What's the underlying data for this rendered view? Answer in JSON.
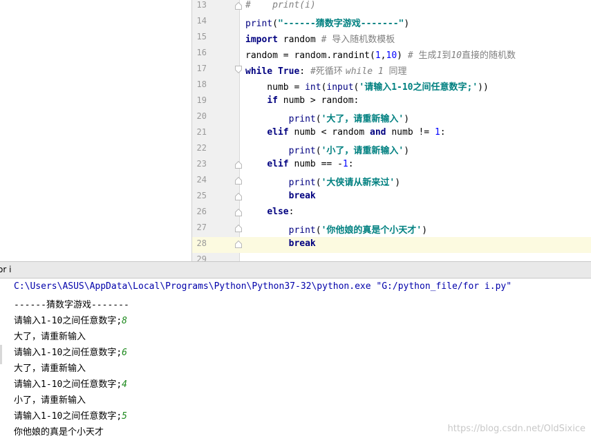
{
  "editor": {
    "lines": [
      {
        "num": "13",
        "tokens": [
          [
            "cmt",
            "#    print(i)"
          ]
        ]
      },
      {
        "num": "14",
        "tokens": [
          [
            "bi",
            "print"
          ],
          [
            "",
            "("
          ],
          [
            "str",
            "\"------猜数字游戏-------\""
          ],
          [
            "",
            ")"
          ]
        ]
      },
      {
        "num": "15",
        "tokens": [
          [
            "kw",
            "import"
          ],
          [
            "",
            " random "
          ],
          [
            "cmt",
            "# "
          ],
          [
            "cmt-zh",
            "导入随机数模板"
          ]
        ]
      },
      {
        "num": "16",
        "tokens": [
          [
            "",
            "random = random.randint("
          ],
          [
            "num",
            "1"
          ],
          [
            "",
            ","
          ],
          [
            "num",
            "10"
          ],
          [
            "",
            ") "
          ],
          [
            "cmt",
            "# "
          ],
          [
            "cmt-zh",
            "生成"
          ],
          [
            "cmt",
            "1"
          ],
          [
            "cmt-zh",
            "到"
          ],
          [
            "cmt",
            "10"
          ],
          [
            "cmt-zh",
            "直接的随机数"
          ]
        ]
      },
      {
        "num": "17",
        "tokens": [
          [
            "kw",
            "while"
          ],
          [
            "",
            " "
          ],
          [
            "kw",
            "True"
          ],
          [
            "",
            ": "
          ],
          [
            "cmt",
            "#"
          ],
          [
            "cmt-zh",
            "死循环 "
          ],
          [
            "cmt",
            "while 1 "
          ],
          [
            "cmt-zh",
            "同理"
          ]
        ]
      },
      {
        "num": "18",
        "tokens": [
          [
            "",
            "    numb = "
          ],
          [
            "bi",
            "int"
          ],
          [
            "",
            "("
          ],
          [
            "bi",
            "input"
          ],
          [
            "",
            "("
          ],
          [
            "str",
            "'请输入1-10之间任意数字;'"
          ],
          [
            "",
            "))"
          ]
        ]
      },
      {
        "num": "19",
        "tokens": [
          [
            "",
            "    "
          ],
          [
            "kw",
            "if"
          ],
          [
            "",
            " numb > random:"
          ]
        ]
      },
      {
        "num": "20",
        "tokens": [
          [
            "",
            "        "
          ],
          [
            "bi",
            "print"
          ],
          [
            "",
            "("
          ],
          [
            "str",
            "'大了，请重新输入'"
          ],
          [
            "",
            ")"
          ]
        ]
      },
      {
        "num": "21",
        "tokens": [
          [
            "",
            "    "
          ],
          [
            "kw",
            "elif"
          ],
          [
            "",
            " numb < random "
          ],
          [
            "kw",
            "and"
          ],
          [
            "",
            " numb != "
          ],
          [
            "num",
            "1"
          ],
          [
            "",
            ":"
          ]
        ]
      },
      {
        "num": "22",
        "tokens": [
          [
            "",
            "        "
          ],
          [
            "bi",
            "print"
          ],
          [
            "",
            "("
          ],
          [
            "str",
            "'小了，请重新输入'"
          ],
          [
            "",
            ")"
          ]
        ]
      },
      {
        "num": "23",
        "tokens": [
          [
            "",
            "    "
          ],
          [
            "kw",
            "elif"
          ],
          [
            "",
            " numb == -"
          ],
          [
            "num",
            "1"
          ],
          [
            "",
            ":"
          ]
        ]
      },
      {
        "num": "24",
        "tokens": [
          [
            "",
            "        "
          ],
          [
            "bi",
            "print"
          ],
          [
            "",
            "("
          ],
          [
            "str",
            "'大侠请从新来过'"
          ],
          [
            "",
            ")"
          ]
        ]
      },
      {
        "num": "25",
        "tokens": [
          [
            "",
            "        "
          ],
          [
            "kw",
            "break"
          ]
        ]
      },
      {
        "num": "26",
        "tokens": [
          [
            "",
            "    "
          ],
          [
            "kw",
            "else"
          ],
          [
            "",
            ":"
          ]
        ]
      },
      {
        "num": "27",
        "tokens": [
          [
            "",
            "        "
          ],
          [
            "bi",
            "print"
          ],
          [
            "",
            "("
          ],
          [
            "str",
            "'你他娘的真是个小天才'"
          ],
          [
            "",
            ")"
          ]
        ]
      },
      {
        "num": "28",
        "tokens": [
          [
            "",
            "        "
          ],
          [
            "kw",
            "break"
          ]
        ]
      },
      {
        "num": "29",
        "tokens": []
      }
    ]
  },
  "run_panel": {
    "title": "or i",
    "console_lines": [
      [
        [
          "cmd",
          "C:\\Users\\ASUS\\AppData\\Local\\Programs\\Python\\Python37-32\\python.exe \"G:/python_file/for i.py\""
        ]
      ],
      [
        [
          "",
          "------"
        ],
        [
          "zh",
          "猜数字游戏"
        ],
        [
          "",
          "-------"
        ]
      ],
      [
        [
          "zh",
          "请输入"
        ],
        [
          "",
          "1-10"
        ],
        [
          "zh",
          "之间任意数字"
        ],
        [
          "",
          ";"
        ],
        [
          "inp",
          "8"
        ]
      ],
      [
        [
          "zh",
          "大了，请重新输入"
        ]
      ],
      [
        [
          "zh",
          "请输入"
        ],
        [
          "",
          "1-10"
        ],
        [
          "zh",
          "之间任意数字"
        ],
        [
          "",
          ";"
        ],
        [
          "inp",
          "6"
        ]
      ],
      [
        [
          "zh",
          "大了，请重新输入"
        ]
      ],
      [
        [
          "zh",
          "请输入"
        ],
        [
          "",
          "1-10"
        ],
        [
          "zh",
          "之间任意数字"
        ],
        [
          "",
          ";"
        ],
        [
          "inp",
          "4"
        ]
      ],
      [
        [
          "zh",
          "小了，请重新输入"
        ]
      ],
      [
        [
          "zh",
          "请输入"
        ],
        [
          "",
          "1-10"
        ],
        [
          "zh",
          "之间任意数字"
        ],
        [
          "",
          ";"
        ],
        [
          "inp",
          "5"
        ]
      ],
      [
        [
          "zh",
          "你他娘的真是个小天才"
        ]
      ]
    ]
  },
  "watermark": "https://blog.csdn.net/OldSixice",
  "colors": {
    "keyword": "#000080",
    "string": "#008080",
    "number": "#0000ff",
    "comment": "#808080",
    "current_line": "#fcfae0",
    "gutter": "#f0f0f0",
    "console_input": "#1e8a1e"
  }
}
